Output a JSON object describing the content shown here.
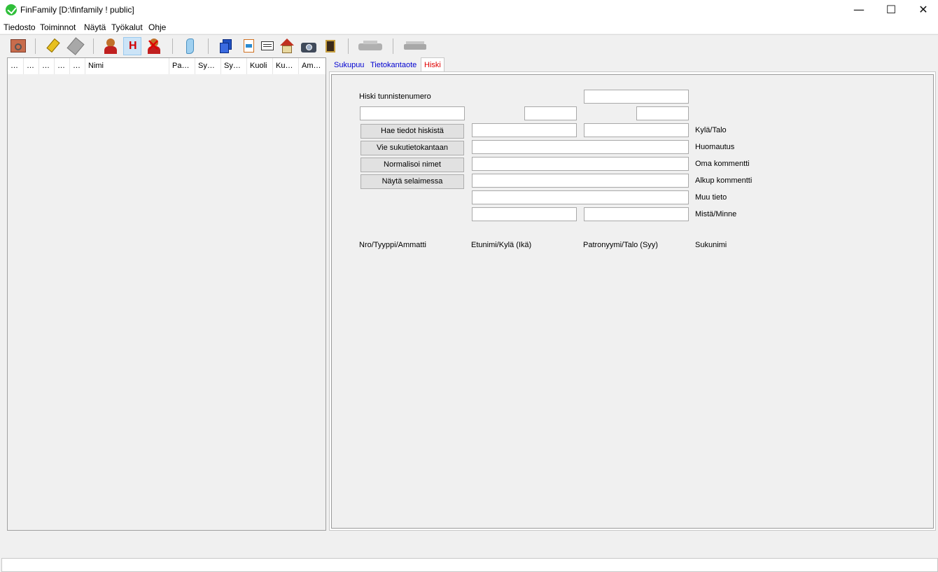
{
  "window": {
    "title": "FinFamily [D:\\finfamily ! public]",
    "minimize": "—",
    "maximize": "☐",
    "close": "✕"
  },
  "menu": [
    "Tiedosto",
    "Toiminnot",
    "Näytä",
    "Työkalut",
    "Ohje"
  ],
  "toolbar": {
    "h_label": "H"
  },
  "list": {
    "columns": [
      "…",
      "…",
      "…",
      "…",
      "…",
      "Nimi",
      "Pa…",
      "Sy…",
      "Sy…",
      "Kuoli",
      "Ku…",
      "Am…"
    ]
  },
  "tabs": [
    "Sukupuu",
    "Tietokantaote",
    "Hiski"
  ],
  "active_tab": "Hiski",
  "hiski": {
    "id_label": "Hiski tunnistenumero",
    "buttons": {
      "fetch": "Hae tiedot hiskistä",
      "export": "Vie sukutietokantaan",
      "normalize": "Normalisoi nimet",
      "browser": "Näytä selaimessa"
    },
    "labels": {
      "village": "Kylä/Talo",
      "note": "Huomautus",
      "own_comment": "Oma kommentti",
      "orig_comment": "Alkup kommentti",
      "other": "Muu tieto",
      "from_to": "Mistä/Minne"
    },
    "columns": {
      "nro": "Nro/Tyyppi/Ammatti",
      "first": "Etunimi/Kylä (Ikä)",
      "patronym": "Patronyymi/Talo (Syy)",
      "surname": "Sukunimi"
    }
  }
}
